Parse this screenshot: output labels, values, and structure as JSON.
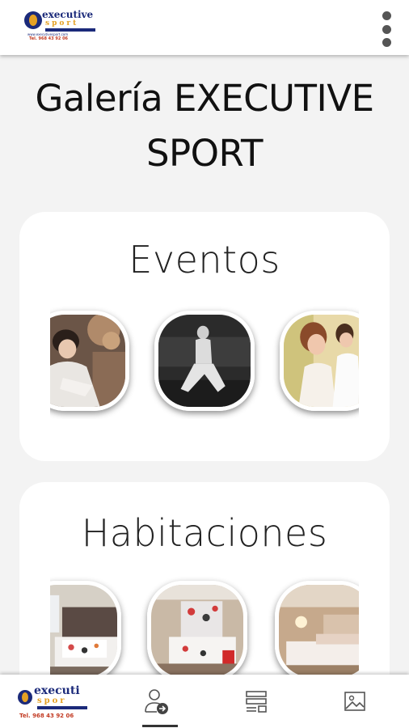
{
  "header": {
    "logo": {
      "brand_top": "executive",
      "brand_bottom": "sport",
      "url": "www.executivesport.com",
      "tel": "Tel. 968 43 92 06"
    },
    "menu_icon": "more-vert-icon"
  },
  "page": {
    "title": "Galería EXECUTIVE SPORT"
  },
  "sections": [
    {
      "title": "Eventos",
      "images": [
        "event-photo-woman-robe",
        "event-photo-bw-seated-woman",
        "event-photo-group-women"
      ]
    },
    {
      "title": "Habitaciones",
      "images": [
        "room-photo-bed-window",
        "room-photo-floral-headboard",
        "room-photo-twin-beds"
      ]
    }
  ],
  "bottom_nav": {
    "logo": {
      "brand_top": "executi",
      "brand_bottom": "spor",
      "tel": "Tel. 968 43 92 06"
    },
    "items": [
      {
        "icon": "profile-arrow-icon",
        "active": true
      },
      {
        "icon": "layout-list-icon",
        "active": false
      },
      {
        "icon": "image-gallery-icon",
        "active": false
      }
    ]
  },
  "colors": {
    "background": "#f3f3f3",
    "card": "#ffffff",
    "brand_blue": "#1b2a7a",
    "brand_orange": "#e5a124"
  }
}
